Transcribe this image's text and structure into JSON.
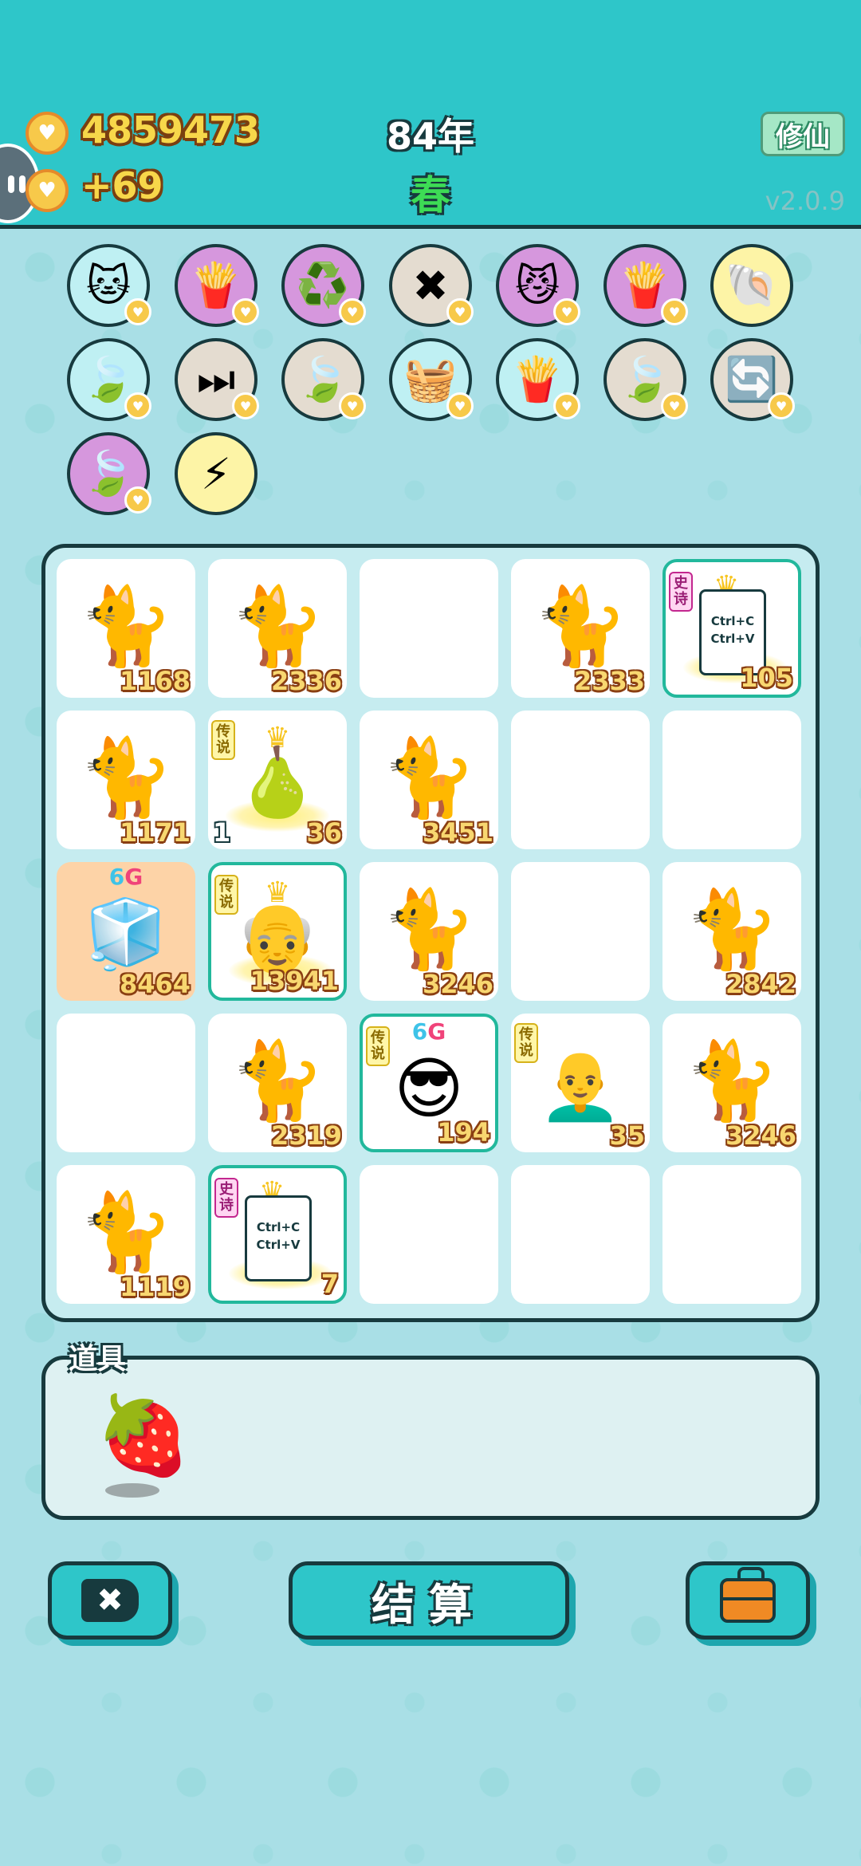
{
  "header": {
    "coins": "4859473",
    "income": "+69",
    "year": "84年",
    "season": "春",
    "mode_button": "修仙",
    "version": "v2.0.9"
  },
  "abilities": [
    {
      "icon": "cat-icon",
      "glyph": "🐱",
      "bg": "#bff0f3"
    },
    {
      "icon": "fries-icon",
      "glyph": "🍟",
      "bg": "#d697dd"
    },
    {
      "icon": "recycle-icon",
      "glyph": "♻️",
      "bg": "#d697dd"
    },
    {
      "icon": "delete-tag-icon",
      "glyph": "✖",
      "bg": "#e4dcd0"
    },
    {
      "icon": "cat-eyes-icon",
      "glyph": "😼",
      "bg": "#d697dd"
    },
    {
      "icon": "fries-icon",
      "glyph": "🍟",
      "bg": "#d697dd"
    },
    {
      "icon": "shell-icon",
      "glyph": "🐚",
      "bg": "#fdf4a6"
    },
    {
      "icon": "leaf-icon",
      "glyph": "🍃",
      "bg": "#bff0f3"
    },
    {
      "icon": "skip-icon",
      "glyph": "⏭",
      "bg": "#e4dcd0"
    },
    {
      "icon": "leaf-icon",
      "glyph": "🍃",
      "bg": "#e4dcd0"
    },
    {
      "icon": "fruit-basket-icon",
      "glyph": "🧺",
      "bg": "#bff0f3"
    },
    {
      "icon": "fries-icon",
      "glyph": "🍟",
      "bg": "#bff0f3"
    },
    {
      "icon": "leaf-icon",
      "glyph": "🍃",
      "bg": "#e4dcd0"
    },
    {
      "icon": "refresh-icon",
      "glyph": "🔄",
      "bg": "#e4dcd0"
    },
    {
      "icon": "leaf-icon",
      "glyph": "🍃",
      "bg": "#d697dd"
    },
    {
      "icon": "lightning-icon",
      "glyph": "⚡",
      "bg": "#fdf4a6"
    }
  ],
  "board": {
    "r0c0": "1168",
    "r0c1": "2336",
    "r0c3": "2333",
    "r0c4": "105",
    "r1c0": "1171",
    "r1c1": "36",
    "r1c1_left": "1",
    "r1c2": "3451",
    "r2c0": "8464",
    "r2c1": "13941",
    "r2c2": "3246",
    "r2c4": "2842",
    "r3c1": "2319",
    "r3c2": "194",
    "r3c3": "35",
    "r3c4": "3246",
    "r4c0": "1119",
    "r4c1": "7"
  },
  "tags": {
    "legend": "传说",
    "epic": "史诗",
    "six": "6",
    "g": "G",
    "copy_line1": "Ctrl+C",
    "copy_line2": "Ctrl+V"
  },
  "props": {
    "label": "道具"
  },
  "buttons": {
    "settle": "结算"
  }
}
